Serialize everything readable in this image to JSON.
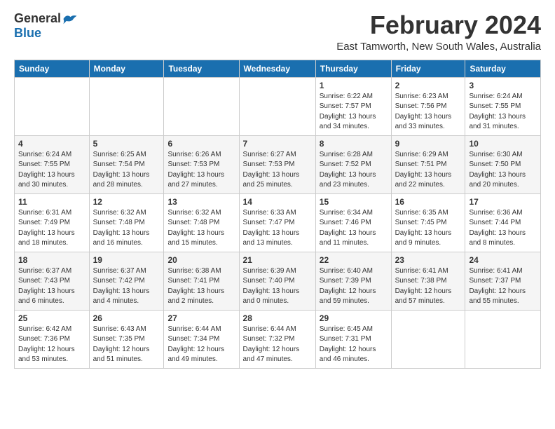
{
  "logo": {
    "general": "General",
    "blue": "Blue"
  },
  "title": "February 2024",
  "subtitle": "East Tamworth, New South Wales, Australia",
  "days_header": [
    "Sunday",
    "Monday",
    "Tuesday",
    "Wednesday",
    "Thursday",
    "Friday",
    "Saturday"
  ],
  "weeks": [
    [
      {
        "day": "",
        "info": ""
      },
      {
        "day": "",
        "info": ""
      },
      {
        "day": "",
        "info": ""
      },
      {
        "day": "",
        "info": ""
      },
      {
        "day": "1",
        "info": "Sunrise: 6:22 AM\nSunset: 7:57 PM\nDaylight: 13 hours\nand 34 minutes."
      },
      {
        "day": "2",
        "info": "Sunrise: 6:23 AM\nSunset: 7:56 PM\nDaylight: 13 hours\nand 33 minutes."
      },
      {
        "day": "3",
        "info": "Sunrise: 6:24 AM\nSunset: 7:55 PM\nDaylight: 13 hours\nand 31 minutes."
      }
    ],
    [
      {
        "day": "4",
        "info": "Sunrise: 6:24 AM\nSunset: 7:55 PM\nDaylight: 13 hours\nand 30 minutes."
      },
      {
        "day": "5",
        "info": "Sunrise: 6:25 AM\nSunset: 7:54 PM\nDaylight: 13 hours\nand 28 minutes."
      },
      {
        "day": "6",
        "info": "Sunrise: 6:26 AM\nSunset: 7:53 PM\nDaylight: 13 hours\nand 27 minutes."
      },
      {
        "day": "7",
        "info": "Sunrise: 6:27 AM\nSunset: 7:53 PM\nDaylight: 13 hours\nand 25 minutes."
      },
      {
        "day": "8",
        "info": "Sunrise: 6:28 AM\nSunset: 7:52 PM\nDaylight: 13 hours\nand 23 minutes."
      },
      {
        "day": "9",
        "info": "Sunrise: 6:29 AM\nSunset: 7:51 PM\nDaylight: 13 hours\nand 22 minutes."
      },
      {
        "day": "10",
        "info": "Sunrise: 6:30 AM\nSunset: 7:50 PM\nDaylight: 13 hours\nand 20 minutes."
      }
    ],
    [
      {
        "day": "11",
        "info": "Sunrise: 6:31 AM\nSunset: 7:49 PM\nDaylight: 13 hours\nand 18 minutes."
      },
      {
        "day": "12",
        "info": "Sunrise: 6:32 AM\nSunset: 7:48 PM\nDaylight: 13 hours\nand 16 minutes."
      },
      {
        "day": "13",
        "info": "Sunrise: 6:32 AM\nSunset: 7:48 PM\nDaylight: 13 hours\nand 15 minutes."
      },
      {
        "day": "14",
        "info": "Sunrise: 6:33 AM\nSunset: 7:47 PM\nDaylight: 13 hours\nand 13 minutes."
      },
      {
        "day": "15",
        "info": "Sunrise: 6:34 AM\nSunset: 7:46 PM\nDaylight: 13 hours\nand 11 minutes."
      },
      {
        "day": "16",
        "info": "Sunrise: 6:35 AM\nSunset: 7:45 PM\nDaylight: 13 hours\nand 9 minutes."
      },
      {
        "day": "17",
        "info": "Sunrise: 6:36 AM\nSunset: 7:44 PM\nDaylight: 13 hours\nand 8 minutes."
      }
    ],
    [
      {
        "day": "18",
        "info": "Sunrise: 6:37 AM\nSunset: 7:43 PM\nDaylight: 13 hours\nand 6 minutes."
      },
      {
        "day": "19",
        "info": "Sunrise: 6:37 AM\nSunset: 7:42 PM\nDaylight: 13 hours\nand 4 minutes."
      },
      {
        "day": "20",
        "info": "Sunrise: 6:38 AM\nSunset: 7:41 PM\nDaylight: 13 hours\nand 2 minutes."
      },
      {
        "day": "21",
        "info": "Sunrise: 6:39 AM\nSunset: 7:40 PM\nDaylight: 13 hours\nand 0 minutes."
      },
      {
        "day": "22",
        "info": "Sunrise: 6:40 AM\nSunset: 7:39 PM\nDaylight: 12 hours\nand 59 minutes."
      },
      {
        "day": "23",
        "info": "Sunrise: 6:41 AM\nSunset: 7:38 PM\nDaylight: 12 hours\nand 57 minutes."
      },
      {
        "day": "24",
        "info": "Sunrise: 6:41 AM\nSunset: 7:37 PM\nDaylight: 12 hours\nand 55 minutes."
      }
    ],
    [
      {
        "day": "25",
        "info": "Sunrise: 6:42 AM\nSunset: 7:36 PM\nDaylight: 12 hours\nand 53 minutes."
      },
      {
        "day": "26",
        "info": "Sunrise: 6:43 AM\nSunset: 7:35 PM\nDaylight: 12 hours\nand 51 minutes."
      },
      {
        "day": "27",
        "info": "Sunrise: 6:44 AM\nSunset: 7:34 PM\nDaylight: 12 hours\nand 49 minutes."
      },
      {
        "day": "28",
        "info": "Sunrise: 6:44 AM\nSunset: 7:32 PM\nDaylight: 12 hours\nand 47 minutes."
      },
      {
        "day": "29",
        "info": "Sunrise: 6:45 AM\nSunset: 7:31 PM\nDaylight: 12 hours\nand 46 minutes."
      },
      {
        "day": "",
        "info": ""
      },
      {
        "day": "",
        "info": ""
      }
    ]
  ]
}
